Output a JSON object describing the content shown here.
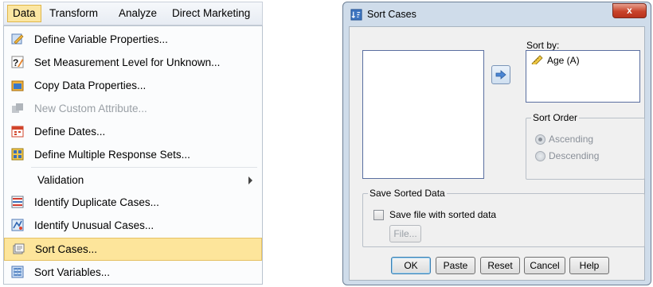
{
  "menubar": {
    "items": [
      {
        "label": "Data",
        "accel": "D"
      },
      {
        "label": "Transform",
        "accel": "T"
      },
      {
        "label": "Analyze",
        "accel": "A"
      },
      {
        "label": "Direct Marketing",
        "accel": "M"
      }
    ]
  },
  "data_menu": {
    "items": [
      {
        "label": "Define Variable Properties...",
        "icon": "define-variable-properties-icon"
      },
      {
        "label": "Set Measurement Level for Unknown...",
        "icon": "measurement-level-icon"
      },
      {
        "label": "Copy Data Properties...",
        "icon": "copy-data-properties-icon"
      },
      {
        "label": "New Custom Attribute...",
        "icon": "custom-attribute-icon",
        "disabled": true
      },
      {
        "label": "Define Dates...",
        "icon": "define-dates-icon"
      },
      {
        "label": "Define Multiple Response Sets...",
        "icon": "multiple-response-icon"
      },
      {
        "label": "Validation",
        "submenu": true
      },
      {
        "label": "Identify Duplicate Cases...",
        "icon": "duplicate-cases-icon"
      },
      {
        "label": "Identify Unusual Cases...",
        "icon": "unusual-cases-icon"
      },
      {
        "label": "Sort Cases...",
        "icon": "sort-cases-icon",
        "highlighted": true
      },
      {
        "label": "Sort Variables...",
        "icon": "sort-variables-icon"
      }
    ]
  },
  "dialog": {
    "title": "Sort Cases",
    "close_label": "x",
    "sort_by_label": "Sort by:",
    "sort_by_items": [
      "Age (A)"
    ],
    "sort_order_label": "Sort Order",
    "ascending_label": "Ascending",
    "descending_label": "Descending",
    "sort_order_selected": "Ascending",
    "save_group_label": "Save Sorted Data",
    "save_checkbox_label": "Save file with sorted data",
    "save_checkbox_checked": false,
    "file_button_label": "File...",
    "buttons": {
      "ok": "OK",
      "paste": "Paste",
      "reset": "Reset",
      "cancel": "Cancel",
      "help": "Help"
    }
  },
  "colors": {
    "menu_highlight": "#fde59b",
    "dialog_frame": "#cfdcea",
    "close_button": "#c8442b"
  }
}
